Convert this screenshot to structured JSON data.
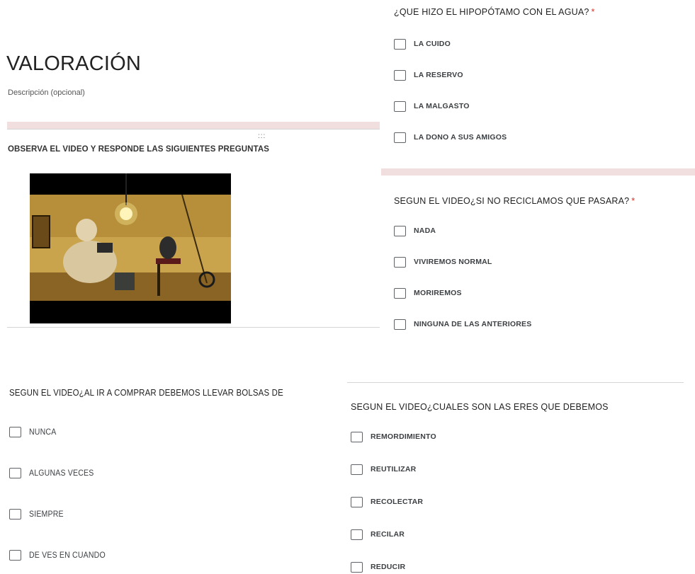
{
  "form": {
    "title": "VALORACIÓN",
    "description": "Descripción (opcional)",
    "drag_handle": ":::",
    "section_title": "OBSERVA EL VIDEO Y RESPONDE LAS SIGUIENTES PREGUNTAS"
  },
  "questions": [
    {
      "title": "¿QUE HIZO EL HIPOPÓTAMO CON EL AGUA?",
      "required": "*",
      "options": [
        "LA CUIDO",
        "LA RESERVO",
        "LA MALGASTO",
        "LA DONO A SUS AMIGOS"
      ]
    },
    {
      "title": "SEGUN EL VIDEO¿SI NO RECICLAMOS QUE PASARA?",
      "required": "*",
      "options": [
        "NADA",
        "VIVIREMOS NORMAL",
        "MORIREMOS",
        "NINGUNA DE LAS ANTERIORES"
      ]
    },
    {
      "title": "SEGUN EL VIDEO¿AL IR A COMPRAR DEBEMOS LLEVAR BOLSAS DE",
      "options": [
        "NUNCA",
        "ALGUNAS VECES",
        "SIEMPRE",
        "DE VES EN CUANDO"
      ]
    },
    {
      "title": "SEGUN EL VIDEO¿CUALES SON LAS ERES QUE DEBEMOS",
      "options": [
        "REMORDIMIENTO",
        "REUTILIZAR",
        "RECOLECTAR",
        "RECILAR",
        "REDUCIR"
      ]
    }
  ],
  "colors": {
    "section_band": "#f1dede",
    "required_star": "#d93025",
    "checkbox_border": "#5f6368"
  }
}
